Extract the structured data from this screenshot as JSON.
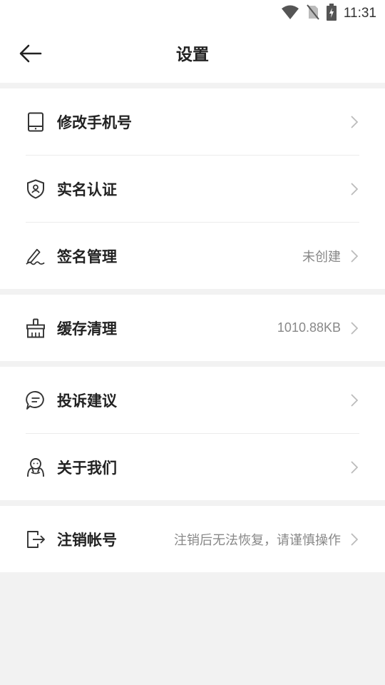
{
  "status_bar": {
    "time": "11:31"
  },
  "header": {
    "title": "设置"
  },
  "groups": [
    {
      "items": [
        {
          "label": "修改手机号",
          "value": ""
        },
        {
          "label": "实名认证",
          "value": ""
        },
        {
          "label": "签名管理",
          "value": "未创建"
        }
      ]
    },
    {
      "items": [
        {
          "label": "缓存清理",
          "value": "1010.88KB"
        }
      ]
    },
    {
      "items": [
        {
          "label": "投诉建议",
          "value": ""
        },
        {
          "label": "关于我们",
          "value": ""
        }
      ]
    },
    {
      "items": [
        {
          "label": "注销帐号",
          "value": "注销后无法恢复，请谨慎操作"
        }
      ]
    }
  ]
}
